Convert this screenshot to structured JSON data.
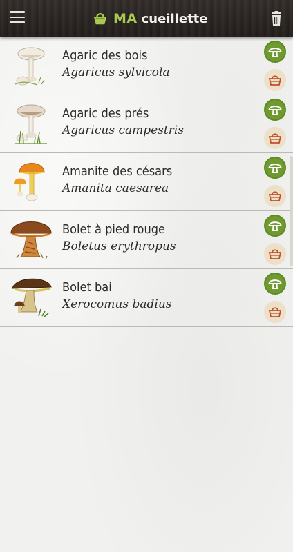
{
  "header": {
    "title_accent": "MA",
    "title_rest": "cueillette",
    "accent_color": "#a9c84e",
    "menu_icon": "hamburger-menu-icon",
    "basket_icon": "basket-icon",
    "delete_icon": "trash-icon"
  },
  "items": [
    {
      "common": "Agaric des bois",
      "latin": "Agaricus sylvicola",
      "image": "white-mushroom"
    },
    {
      "common": "Agaric des prés",
      "latin": "Agaricus campestris",
      "image": "white-mushroom-grass"
    },
    {
      "common": "Amanite des césars",
      "latin": "Amanita caesarea",
      "image": "orange-amanita"
    },
    {
      "common": "Bolet à pied rouge",
      "latin": "Boletus erythropus",
      "image": "brown-bolete-red-stem"
    },
    {
      "common": "Bolet bai",
      "latin": "Xerocomus badius",
      "image": "dark-brown-bolete"
    }
  ],
  "colors": {
    "header_bg": "#2b2623",
    "mushroom_button": "#6f9a2f",
    "basket_button": "#ede0c8",
    "basket_stroke": "#c0502a"
  }
}
